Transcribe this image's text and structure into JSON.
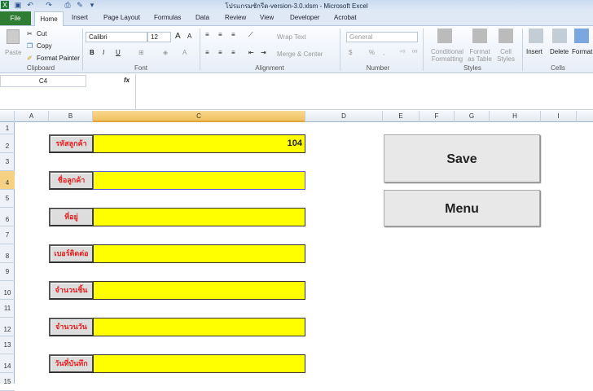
{
  "window": {
    "title": "โปรแกรมซักรีด-version-3.0.xlsm  -  Microsoft Excel"
  },
  "tabs": [
    "File",
    "Home",
    "Insert",
    "Page Layout",
    "Formulas",
    "Data",
    "Review",
    "View",
    "Developer",
    "Acrobat"
  ],
  "ribbon": {
    "clipboard": {
      "paste": "Paste",
      "cut": "Cut",
      "copy": "Copy",
      "format_painter": "Format Painter",
      "label": "Clipboard"
    },
    "font": {
      "name": "Calibri",
      "size": "12",
      "bold": "B",
      "italic": "I",
      "underline": "U",
      "label": "Font"
    },
    "alignment": {
      "wrap": "Wrap Text",
      "merge": "Merge & Center",
      "label": "Alignment"
    },
    "number": {
      "format": "General",
      "percent": "%",
      "comma": ",",
      "label": "Number"
    },
    "styles": {
      "conditional": "Conditional Formatting",
      "format_table": "Format as Table",
      "cell_styles": "Cell Styles",
      "label": "Styles"
    },
    "cells": {
      "insert": "Insert",
      "delete": "Delete",
      "format": "Format",
      "label": "Cells"
    }
  },
  "formula_bar": {
    "name_box": "C4",
    "fx": "fx",
    "value": ""
  },
  "columns": [
    "A",
    "B",
    "C",
    "D",
    "E",
    "F",
    "G",
    "H",
    "I"
  ],
  "rows": [
    "1",
    "2",
    "3",
    "4",
    "5",
    "6",
    "7",
    "8",
    "9",
    "10",
    "11",
    "12",
    "13",
    "14",
    "15"
  ],
  "form": [
    {
      "label": "รหัสลูกค้า",
      "value": "104"
    },
    {
      "label": "ชื่อลูกค้า",
      "value": ""
    },
    {
      "label": "ที่อยู่",
      "value": ""
    },
    {
      "label": "เบอร์ติดต่อ",
      "value": ""
    },
    {
      "label": "จำนวนชิ้น",
      "value": ""
    },
    {
      "label": "จำนวนวัน",
      "value": ""
    },
    {
      "label": "วันที่บันทึก",
      "value": ""
    }
  ],
  "buttons": {
    "save": "Save",
    "menu": "Menu"
  }
}
